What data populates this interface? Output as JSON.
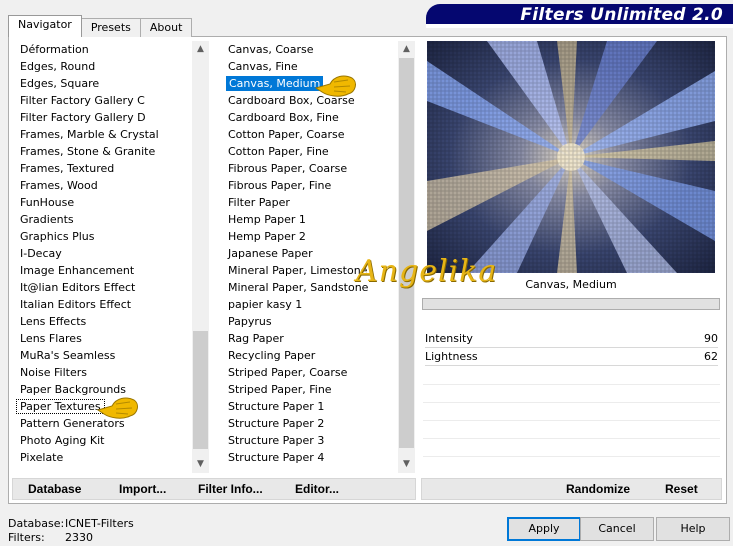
{
  "tabs": [
    {
      "label": "Navigator",
      "active": true
    },
    {
      "label": "Presets",
      "active": false
    },
    {
      "label": "About",
      "active": false
    }
  ],
  "banner": {
    "title": "Filters Unlimited 2.0"
  },
  "categories": {
    "items": [
      "Déformation",
      "Edges, Round",
      "Edges, Square",
      "Filter Factory Gallery C",
      "Filter Factory Gallery D",
      "Frames, Marble & Crystal",
      "Frames, Stone & Granite",
      "Frames, Textured",
      "Frames, Wood",
      "FunHouse",
      "Gradients",
      "Graphics Plus",
      "I-Decay",
      "Image Enhancement",
      "It@lian Editors Effect",
      "Italian Editors Effect",
      "Lens Effects",
      "Lens Flares",
      "MuRa's Seamless",
      "Noise Filters",
      "Paper Backgrounds",
      "Paper Textures",
      "Pattern Generators",
      "Photo Aging Kit",
      "Pixelate"
    ],
    "selected": "Paper Textures"
  },
  "filters": {
    "items": [
      "Canvas, Coarse",
      "Canvas, Fine",
      "Canvas, Medium",
      "Cardboard Box, Coarse",
      "Cardboard Box, Fine",
      "Cotton Paper, Coarse",
      "Cotton Paper, Fine",
      "Fibrous Paper, Coarse",
      "Fibrous Paper, Fine",
      "Filter Paper",
      "Hemp Paper 1",
      "Hemp Paper 2",
      "Japanese Paper",
      "Mineral Paper, Limestone",
      "Mineral Paper, Sandstone",
      "papier kasy 1",
      "Papyrus",
      "Rag Paper",
      "Recycling Paper",
      "Striped Paper, Coarse",
      "Striped Paper, Fine",
      "Structure Paper 1",
      "Structure Paper 2",
      "Structure Paper 3",
      "Structure Paper 4"
    ],
    "selected": "Canvas, Medium"
  },
  "preview": {
    "filter_name": "Canvas, Medium"
  },
  "watermark": "Angelika",
  "sliders": [
    {
      "label": "Intensity",
      "value": "90"
    },
    {
      "label": "Lightness",
      "value": "62"
    }
  ],
  "left_buttons": {
    "database": "Database",
    "import": "Import...",
    "filter_info": "Filter Info...",
    "editor": "Editor..."
  },
  "right_buttons": {
    "randomize": "Randomize",
    "reset": "Reset"
  },
  "status": {
    "database_label": "Database:",
    "database_value": "ICNET-Filters",
    "filters_label": "Filters:",
    "filters_value": "2330"
  },
  "dialog_buttons": {
    "apply": "Apply",
    "cancel": "Cancel",
    "help": "Help"
  },
  "colors": {
    "banner": "#050770",
    "selection": "#0078d7",
    "watermark": "#e7b516"
  }
}
